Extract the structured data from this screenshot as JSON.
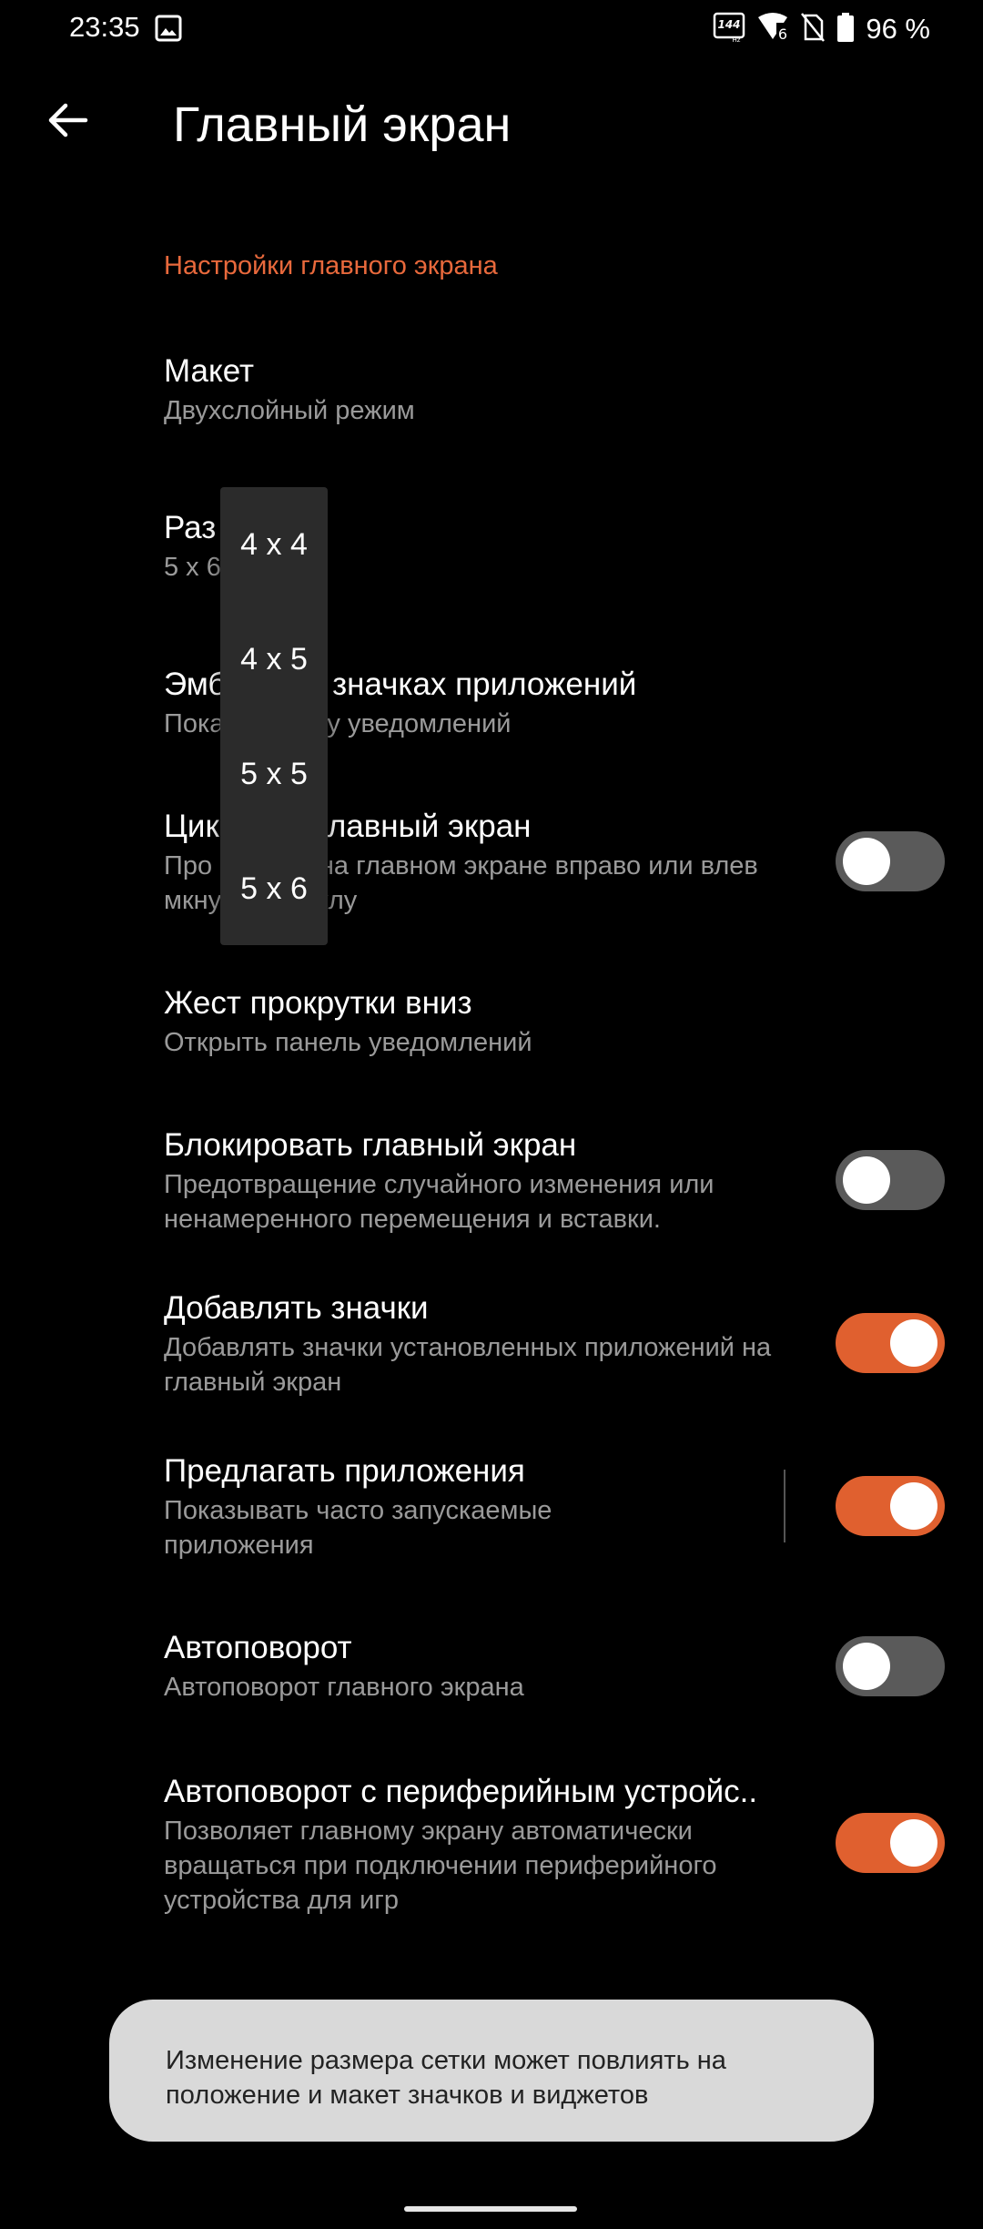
{
  "status_bar": {
    "time": "23:35",
    "battery_percent": "96 %",
    "refresh_rate": "144",
    "refresh_unit": "Hz",
    "signal_label": "6",
    "icons": [
      "image-icon",
      "refresh-rate-icon",
      "wifi-6-icon",
      "no-sim-icon",
      "battery-icon"
    ]
  },
  "header": {
    "title": "Главный экран",
    "back_icon": "arrow-left-icon"
  },
  "section": {
    "title": "Настройки главного экрана"
  },
  "settings": [
    {
      "title": "Макет",
      "summary": "Двухслойный режим"
    },
    {
      "title": "Раз     тки",
      "summary": "5 x 6"
    },
    {
      "title": "Эмб       на значках приложений",
      "summary": "Пока       точку уведомлений"
    },
    {
      "title": "Цик        й главный экран",
      "summary": "Про        йте на главном экране вправо или влев         мкнутому циклу",
      "toggle": false
    },
    {
      "title": "Жест прокрутки вниз",
      "summary": "Открыть панель уведомлений"
    },
    {
      "title": "Блокировать главный экран",
      "summary": "Предотвращение случайного изменения или ненамеренного перемещения и вставки.",
      "toggle": false
    },
    {
      "title": "Добавлять значки",
      "summary": "Добавлять значки установленных приложений на главный экран",
      "toggle": true
    },
    {
      "title": "Предлагать приложения",
      "summary": "Показывать часто запускаемые приложения",
      "toggle": true
    },
    {
      "title": "Автоповорот",
      "summary": "Автоповорот главного экрана",
      "toggle": false
    },
    {
      "title": "Автоповорот с периферийным устройс..",
      "summary": "Позволяет главному экрану автоматически вращаться при подключении периферийного устройства для игр",
      "toggle": true
    }
  ],
  "dropdown": {
    "options": [
      "4 x 4",
      "4 x 5",
      "5 x 5",
      "5 x 6"
    ]
  },
  "toast": {
    "message": "Изменение размера сетки может повлиять на положение и макет значков и виджетов"
  },
  "colors": {
    "accent": "#e0602f",
    "section_header": "#e8693c",
    "background": "#000000",
    "toast_bg": "#d9d9d9"
  }
}
